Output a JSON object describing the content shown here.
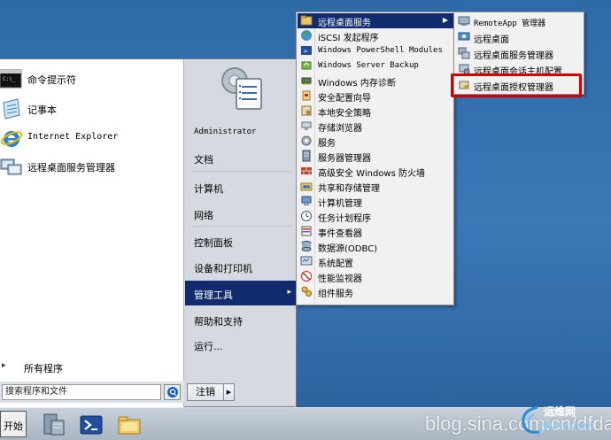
{
  "start_menu": {
    "pinned": [
      {
        "label": "命令提示符",
        "icon": "cmd-icon"
      },
      {
        "label": "记事本",
        "icon": "notepad-icon"
      },
      {
        "label": "Internet Explorer",
        "icon": "ie-icon"
      },
      {
        "label": "远程桌面服务管理器",
        "icon": "rds-manager-icon"
      }
    ],
    "all_programs": "所有程序",
    "search_placeholder": "搜索程序和文件",
    "right": {
      "user": "Administrator",
      "documents": "文档",
      "computer": "计算机",
      "network": "网络",
      "control_panel": "控制面板",
      "devices_printers": "设备和打印机",
      "admin_tools": "管理工具",
      "help": "帮助和支持",
      "run": "运行..."
    },
    "shutdown": "注销"
  },
  "admin_tools_menu": {
    "items": [
      "远程桌面服务",
      "iSCSI 发起程序",
      "Windows PowerShell Modules",
      "Windows Server Backup",
      "Windows 内存诊断",
      "安全配置向导",
      "本地安全策略",
      "存储浏览器",
      "服务",
      "服务器管理器",
      "高级安全 Windows 防火墙",
      "共享和存储管理",
      "计算机管理",
      "任务计划程序",
      "事件查看器",
      "数据源(ODBC)",
      "系统配置",
      "性能监视器",
      "组件服务"
    ]
  },
  "remote_desktop_menu": {
    "items": [
      "RemoteApp 管理器",
      "远程桌面",
      "远程桌面服务管理器",
      "远程桌面会话主机配置",
      "远程桌面授权管理器"
    ]
  },
  "taskbar": {
    "start_label": "开始"
  },
  "watermark": {
    "url": "blog.sina.com.cn/dfdap",
    "logo_cn": "运维网",
    "logo_en": "iyunv.com"
  },
  "colors": {
    "selection": "#102b6e",
    "highlight_border": "#d40000",
    "desktop": "#3a6ea5"
  }
}
